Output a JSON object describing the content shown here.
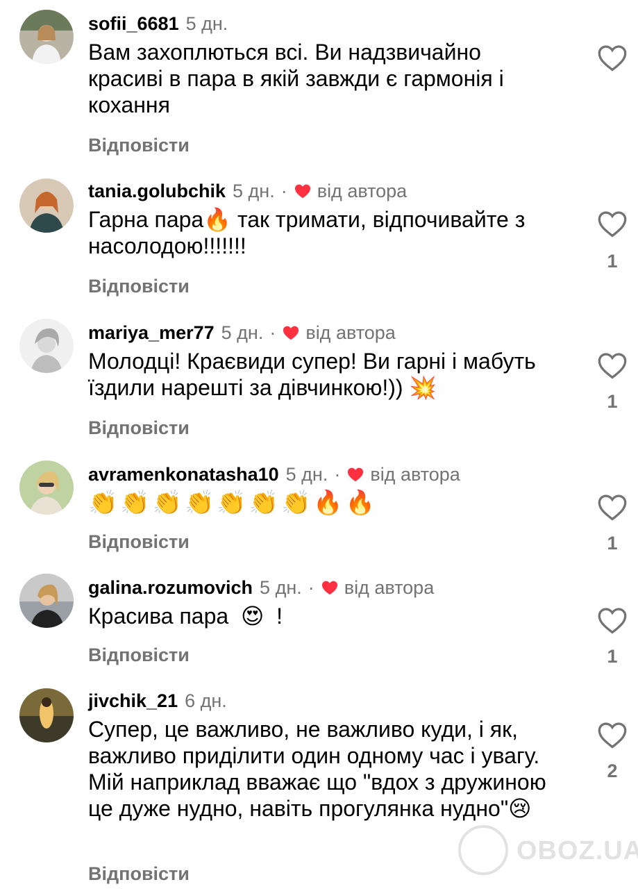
{
  "reply_label": "Відповісти",
  "author_badge": "від автора",
  "dot": "·",
  "colors": {
    "username": "#000000",
    "secondary": "#737373",
    "heart_red": "#ff3040"
  },
  "comments": [
    {
      "username": "sofii_6681",
      "time": "5 дн.",
      "liked_by_author": false,
      "text": "Вам захоплються всі. Ви надзвичайно красиві в пара в якій завжди є гармонія і кохання",
      "likes": ""
    },
    {
      "username": "tania.golubchik",
      "time": "5 дн.",
      "liked_by_author": true,
      "text_before": "Гарна пара",
      "emoji": "🔥",
      "text_after": "так тримати, відпочивайте з насолодою!!!!!!!",
      "likes": "1"
    },
    {
      "username": "mariya_mer77",
      "time": "5 дн.",
      "liked_by_author": true,
      "text": "Молодці! Краєвиди супер! Ви гарні і мабуть їздили нарешті за дівчинкою!))",
      "emoji": "💥",
      "likes": "1"
    },
    {
      "username": "avramenkonatasha10",
      "time": "5 дн.",
      "liked_by_author": true,
      "text": "👏👏👏👏👏👏👏🔥🔥",
      "likes": "1"
    },
    {
      "username": "galina.rozumovich",
      "time": "5 дн.",
      "liked_by_author": true,
      "text_before": "Красива пара",
      "emoji": "😍",
      "text_after": "!",
      "likes": "1"
    },
    {
      "username": "jivchik_21",
      "time": "6 дн.",
      "liked_by_author": false,
      "text": "Супер, це важливо, не важливо куди, і як, важливо приділити один одному час і увагу. Мій наприклад вважає що \"вдох з дружиною це дуже нудно, навіть прогулянка нудно\"",
      "emoji": "😢",
      "likes": "2"
    }
  ],
  "watermark": "OBOZ.UA"
}
